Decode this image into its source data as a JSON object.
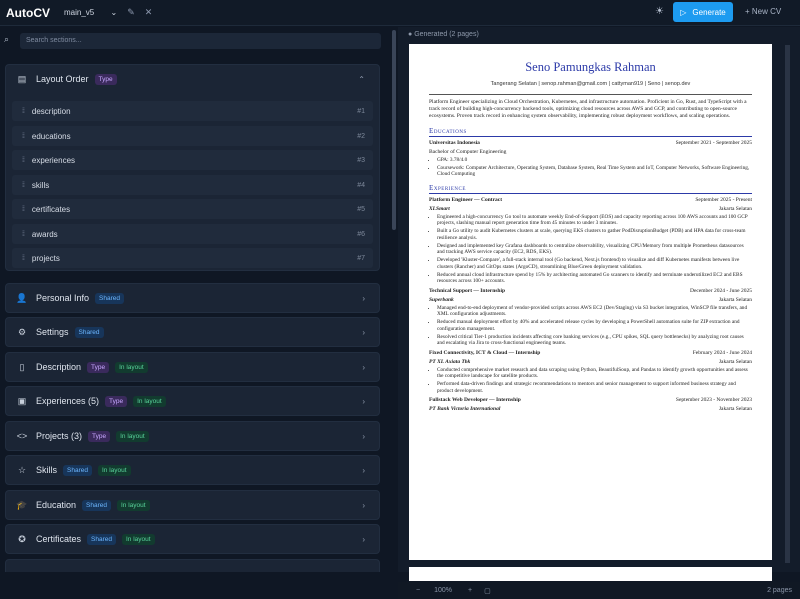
{
  "app": {
    "title": "AutoCV",
    "branch": "main_v5",
    "generate_label": "Generate",
    "new_cv_label": "+ New CV"
  },
  "search": {
    "placeholder": "Search sections..."
  },
  "layout_order": {
    "title": "Layout Order",
    "badge": "Type",
    "items": [
      {
        "label": "description",
        "num": "#1"
      },
      {
        "label": "educations",
        "num": "#2"
      },
      {
        "label": "experiences",
        "num": "#3"
      },
      {
        "label": "skills",
        "num": "#4"
      },
      {
        "label": "certificates",
        "num": "#5"
      },
      {
        "label": "awards",
        "num": "#6"
      },
      {
        "label": "projects",
        "num": "#7"
      }
    ]
  },
  "sections": [
    {
      "title": "Personal Info",
      "badges": [
        "Shared"
      ]
    },
    {
      "title": "Settings",
      "badges": [
        "Shared"
      ]
    },
    {
      "title": "Description",
      "badges": [
        "Type",
        "In layout"
      ]
    },
    {
      "title": "Experiences (5)",
      "badges": [
        "Type",
        "In layout"
      ]
    },
    {
      "title": "Projects (3)",
      "badges": [
        "Type",
        "In layout"
      ]
    },
    {
      "title": "Skills",
      "badges": [
        "Shared",
        "In layout"
      ]
    },
    {
      "title": "Education",
      "badges": [
        "Shared",
        "In layout"
      ]
    },
    {
      "title": "Certificates",
      "badges": [
        "Shared",
        "In layout"
      ]
    }
  ],
  "preview": {
    "label": "Generated (2 pages)",
    "zoom": "100%",
    "pages": "2 pages",
    "cv": {
      "name": "Seno Pamungkas Rahman",
      "contact": "Tangerang Selatan | senop.rahman@gmail.com | cattyman919 | Seno | senop.dev",
      "summary": "Platform Engineer specializing in Cloud Orchestration, Kubernetes, and infrastructure automation. Proficient in Go, Rust, and TypeScript with a track record of building high-concurrency backend tools, optimizing cloud resources across AWS and GCP, and contributing to open-source ecosystems. Proven track record in enhancing system observability, implementing robust deployment workflows, and scaling operations.",
      "edu_title": "Educations",
      "edu": {
        "school": "Universitas Indonesia",
        "dates": "September 2021 - September 2025",
        "degree": "Bachelor of Computer Engineering",
        "gpa": "GPA: 3.78/4.0",
        "courses": "Coursework: Computer Architecture, Operating System, Database System, Real Time System and IoT, Computer Networks, Software Engineering, Cloud Computing"
      },
      "exp_title": "Experience",
      "jobs": [
        {
          "role": "Platform Engineer — Contract",
          "dates": "September 2025 - Present",
          "company": "XLSmart",
          "loc": "Jakarta Selatan",
          "bullets": [
            "Engineered a high-concurrency Go tool to automate weekly End-of-Support (EOS) and capacity reporting across 100 AWS accounts and 100 GCP projects, slashing manual report generation time from 45 minutes to under 3 minutes.",
            "Built a Go utility to audit Kubernetes clusters at scale, querying EKS clusters to gather PodDisruptionBudget (PDB) and HPA data for cross-team resilience analysis.",
            "Designed and implemented key Grafana dashboards to centralize observability, visualizing CPU/Memory from multiple Prometheus datasources and tracking AWS service capacity (EC2, RDS, EKS).",
            "Developed 'Kluster-Compare', a full-stack internal tool (Go backend, Next.js frontend) to visualize and diff Kubernetes manifests between live clusters (Rancher) and GitOps states (ArgoCD), streamlining Blue/Green deployment validation.",
            "Reduced annual cloud infrastructure spend by 15% by architecting automated Go scanners to identify and terminate underutilized EC2 and EBS resources across 100+ accounts."
          ]
        },
        {
          "role": "Technical Support — Internship",
          "dates": "December 2024 - June 2025",
          "company": "Superbank",
          "loc": "Jakarta Selatan",
          "bullets": [
            "Managed end-to-end deployment of vendor-provided scripts across AWS EC2 (Dev/Staging) via S3 bucket integration, WinSCP file transfers, and XML configuration adjustments.",
            "Reduced manual deployment effort by 40% and accelerated release cycles by developing a PowerShell automation suite for ZIP extraction and configuration management.",
            "Resolved critical Tier-1 production incidents affecting core banking services (e.g., CPU spikes, SQL query bottlenecks) by analyzing root causes and escalating via Jira to cross-functional engineering teams."
          ]
        },
        {
          "role": "Fixed Connectivity, ICT & Cloud — Internship",
          "dates": "February 2024 - June 2024",
          "company": "PT XL Axiata Tbk",
          "loc": "Jakarta Selatan",
          "bullets": [
            "Conducted comprehensive market research and data scraping using Python, BeautifulSoup, and Pandas to identify growth opportunities and assess the competitive landscape for satellite products.",
            "Performed data-driven findings and strategic recommendations to mentors and senior management to support informed business strategy and product development."
          ]
        },
        {
          "role": "Fullstack Web Developer — Internship",
          "dates": "September 2023 - November 2023",
          "company": "PT Bank Victoria International",
          "loc": "Jakarta Selatan",
          "bullets": []
        }
      ]
    }
  }
}
